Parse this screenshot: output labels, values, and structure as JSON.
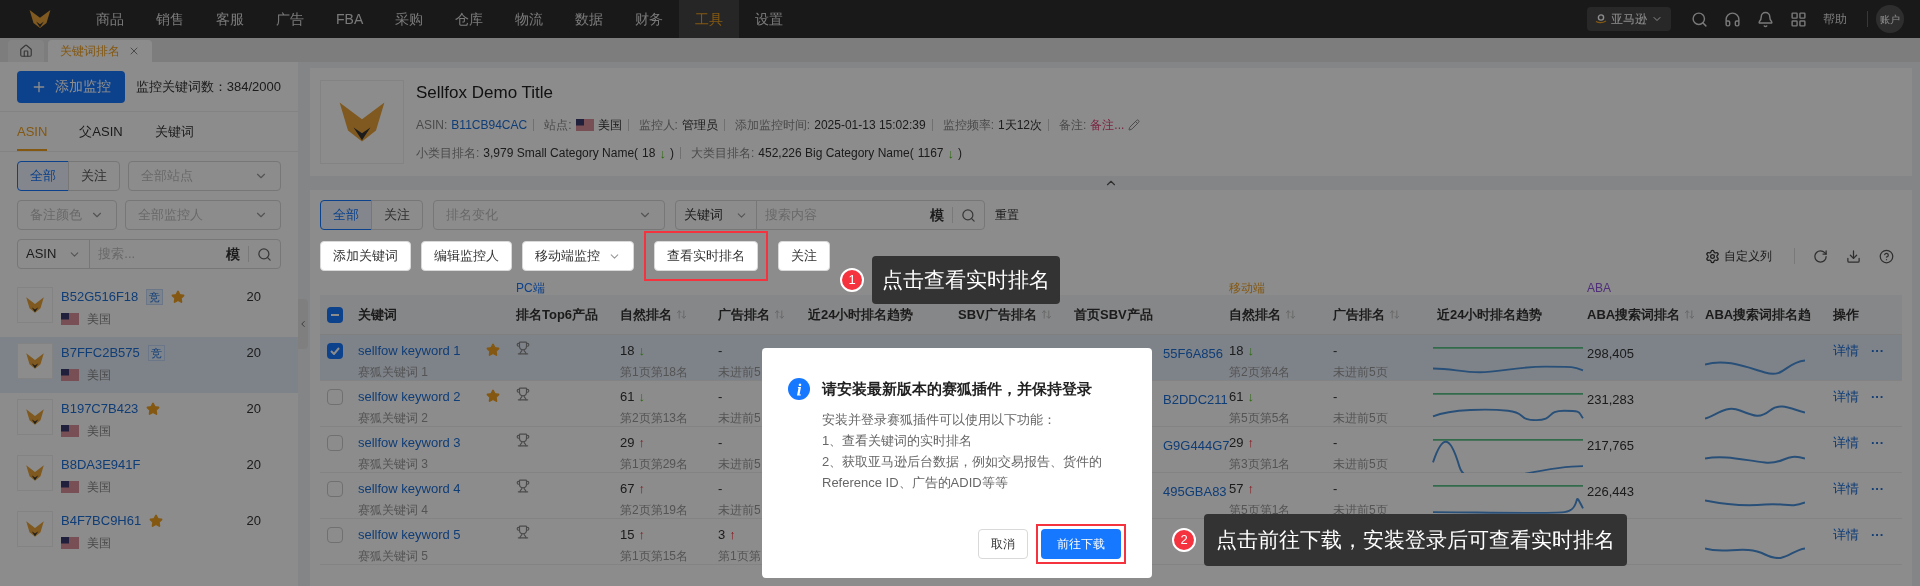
{
  "nav": {
    "items": [
      {
        "label": "商品",
        "selected": false
      },
      {
        "label": "销售",
        "selected": false
      },
      {
        "label": "客服",
        "selected": false
      },
      {
        "label": "广告",
        "selected": false
      },
      {
        "label": "FBA",
        "selected": false
      },
      {
        "label": "采购",
        "selected": false
      },
      {
        "label": "仓库",
        "selected": false
      },
      {
        "label": "物流",
        "selected": false
      },
      {
        "label": "数据",
        "selected": false
      },
      {
        "label": "财务",
        "selected": false
      },
      {
        "label": "工具",
        "selected": true
      },
      {
        "label": "设置",
        "selected": false
      }
    ],
    "marketplace": "亚马逊",
    "help": "帮助",
    "account": "账户"
  },
  "tabs": [
    {
      "label": "关键词排名",
      "selected": true
    }
  ],
  "sidebar": {
    "add_button": "添加监控",
    "count_label": "监控关键词数：384/2000",
    "tabs": [
      {
        "label": "ASIN",
        "selected": true
      },
      {
        "label": "父ASIN",
        "selected": false
      },
      {
        "label": "关键词",
        "selected": false
      }
    ],
    "filter_toggle": [
      {
        "label": "全部",
        "selected": true
      },
      {
        "label": "关注",
        "selected": false
      }
    ],
    "site_select": {
      "placeholder": "全部站点"
    },
    "color_select": {
      "placeholder": "备注颜色"
    },
    "owner_select": {
      "placeholder": "全部监控人"
    },
    "search_type": "ASIN",
    "search": {
      "placeholder": "搜索..."
    },
    "fuzzy": "模",
    "items": [
      {
        "asin": "B52G516F18",
        "tag": "竞",
        "starred": true,
        "country": "美国",
        "count": "20",
        "selected": false
      },
      {
        "asin": "B7FFC2B575",
        "tag": "竞",
        "starred": false,
        "country": "美国",
        "count": "20",
        "selected": true
      },
      {
        "asin": "B197C7B423",
        "starred": true,
        "country": "美国",
        "count": "20",
        "selected": false
      },
      {
        "asin": "B8DA3E941F",
        "starred": false,
        "country": "美国",
        "count": "20",
        "selected": false
      },
      {
        "asin": "B4F7BC9H61",
        "starred": true,
        "country": "美国",
        "count": "20",
        "selected": false
      }
    ]
  },
  "product": {
    "title": "Sellfox Demo Title",
    "meta": [
      {
        "label": "ASIN:",
        "value": "B11CB94CAC",
        "kind": "link"
      },
      {
        "label": "站点:",
        "value": "美国",
        "kind": "flag"
      },
      {
        "label": "监控人:",
        "value": "管理员",
        "kind": "text"
      },
      {
        "label": "添加监控时间:",
        "value": "2025-01-13 15:02:39",
        "kind": "text"
      },
      {
        "label": "监控频率:",
        "value": "1天12次",
        "kind": "text"
      },
      {
        "label": "备注:",
        "value": "备注...",
        "kind": "note"
      }
    ],
    "ranks": [
      {
        "label": "小类目排名:",
        "value": "3,979 Small Category Name(",
        "change": "18",
        "arrow": "↓",
        "rising": false,
        "close": ")"
      },
      {
        "label": "大类目排名:",
        "value": "452,226 Big Category Name(",
        "change": "1167",
        "arrow": "↓",
        "rising": false,
        "close": ")"
      }
    ]
  },
  "filters": {
    "toggle": [
      {
        "label": "全部",
        "selected": true
      },
      {
        "label": "关注",
        "selected": false
      }
    ],
    "rank_change": {
      "placeholder": "排名变化"
    },
    "field_type": "关键词",
    "search": {
      "placeholder": "搜索内容"
    },
    "fuzzy": "模",
    "reset": "重置"
  },
  "toolbar": {
    "buttons": [
      {
        "label": "添加关键词",
        "kind": "plain",
        "highlighted": false
      },
      {
        "label": "编辑监控人",
        "kind": "plain",
        "highlighted": false
      },
      {
        "label": "移动端监控",
        "kind": "dropdown",
        "highlighted": false
      },
      {
        "label": "查看实时排名",
        "kind": "plain",
        "highlighted": true
      },
      {
        "label": "关注",
        "kind": "plain",
        "highlighted": false
      }
    ],
    "custom_columns": "自定义列"
  },
  "table": {
    "groups": [
      {
        "label": "PC端",
        "color": "#0c418c"
      },
      {
        "label": "移动端",
        "color": "#845812"
      },
      {
        "label": "ABA",
        "color": "#502e7a"
      }
    ],
    "select_all_indeterminate": true,
    "columns": [
      {
        "label": "关键词",
        "sortable": false
      },
      {
        "label": "排名Top6产品",
        "sortable": false
      },
      {
        "label": "自然排名",
        "sortable": true
      },
      {
        "label": "广告排名",
        "sortable": true
      },
      {
        "label": "近24小时排名趋势",
        "sortable": false
      },
      {
        "label": "SBV广告排名",
        "sortable": true
      },
      {
        "label": "首页SBV产品",
        "sortable": false
      },
      {
        "label": "自然排名",
        "sortable": true
      },
      {
        "label": "广告排名",
        "sortable": true
      },
      {
        "label": "近24小时排名趋势",
        "sortable": false
      },
      {
        "label": "ABA搜索词排名",
        "sortable": true
      },
      {
        "label": "ABA搜索词排名趋",
        "sortable": false
      },
      {
        "label": "操作",
        "sortable": false
      }
    ],
    "rows": [
      {
        "keyword": "sellfow keyword 1",
        "subtitle": "赛狐关键词 1",
        "starred": true,
        "checked": true,
        "selected": true,
        "pc_rank": {
          "value": "18",
          "arrow": "↓",
          "rising": false,
          "detail": "第1页第18名"
        },
        "pc_ad": {
          "value": "-",
          "detail": "未进前5"
        },
        "sbv_product": "55F6A856",
        "mobile_rank": {
          "value": "18",
          "arrow": "↓",
          "rising": false,
          "detail": "第2页第4名"
        },
        "mobile_ad": {
          "value": "-",
          "detail": "未进前5页"
        },
        "aba_rank": "298,405",
        "action": "详情",
        "more": "···"
      },
      {
        "keyword": "sellfow keyword 2",
        "subtitle": "赛狐关键词 2",
        "starred": true,
        "checked": false,
        "selected": false,
        "pc_rank": {
          "value": "61",
          "arrow": "↓",
          "rising": false,
          "detail": "第2页第13名"
        },
        "pc_ad": {
          "value": "-",
          "detail": "未进前5"
        },
        "sbv_product": "B2DDC211",
        "mobile_rank": {
          "value": "61",
          "arrow": "↓",
          "rising": false,
          "detail": "第5页第5名"
        },
        "mobile_ad": {
          "value": "-",
          "detail": "未进前5页"
        },
        "aba_rank": "231,283",
        "action": "详情",
        "more": "···"
      },
      {
        "keyword": "sellfow keyword 3",
        "subtitle": "赛狐关键词 3",
        "starred": false,
        "checked": false,
        "selected": false,
        "pc_rank": {
          "value": "29",
          "arrow": "↑",
          "rising": true,
          "detail": "第1页第29名"
        },
        "pc_ad": {
          "value": "-",
          "detail": "未进前5"
        },
        "sbv_product": "G9G444G7",
        "mobile_rank": {
          "value": "29",
          "arrow": "↑",
          "rising": true,
          "detail": "第3页第1名"
        },
        "mobile_ad": {
          "value": "-",
          "detail": "未进前5页"
        },
        "aba_rank": "217,765",
        "action": "详情",
        "more": "···"
      },
      {
        "keyword": "sellfow keyword 4",
        "subtitle": "赛狐关键词 4",
        "starred": false,
        "checked": false,
        "selected": false,
        "pc_rank": {
          "value": "67",
          "arrow": "↑",
          "rising": true,
          "detail": "第2页第19名"
        },
        "pc_ad": {
          "value": "-",
          "detail": "未进前5"
        },
        "sbv_product": "495GBA83",
        "mobile_rank": {
          "value": "57",
          "arrow": "↑",
          "rising": true,
          "detail": "第5页第1名"
        },
        "mobile_ad": {
          "value": "-",
          "detail": "未进前5页"
        },
        "aba_rank": "226,443",
        "action": "详情",
        "more": "···"
      },
      {
        "keyword": "sellfow keyword 5",
        "subtitle": "赛狐关键词 5",
        "starred": false,
        "checked": false,
        "selected": false,
        "pc_rank": {
          "value": "15",
          "arrow": "↑",
          "rising": true,
          "detail": "第1页第15名"
        },
        "pc_ad": {
          "value": "3",
          "arrow": "↑",
          "rising": true,
          "detail": "第1页第"
        },
        "action": "详情",
        "more": "···"
      }
    ]
  },
  "dialog": {
    "title": "请安装最新版本的赛狐插件，并保持登录",
    "body": [
      "安装并登录赛狐插件可以使用以下功能：",
      "1、查看关键词的实时排名",
      "2、获取亚马逊后台数据，例如交易报告、货件的Reference ID、广告的ADID等等"
    ],
    "cancel": "取消",
    "confirm": "前往下载"
  },
  "guides": [
    {
      "number": "1",
      "text": "点击查看实时排名"
    },
    {
      "number": "2",
      "text": "点击前往下载，安装登录后可查看实时排名"
    }
  ]
}
